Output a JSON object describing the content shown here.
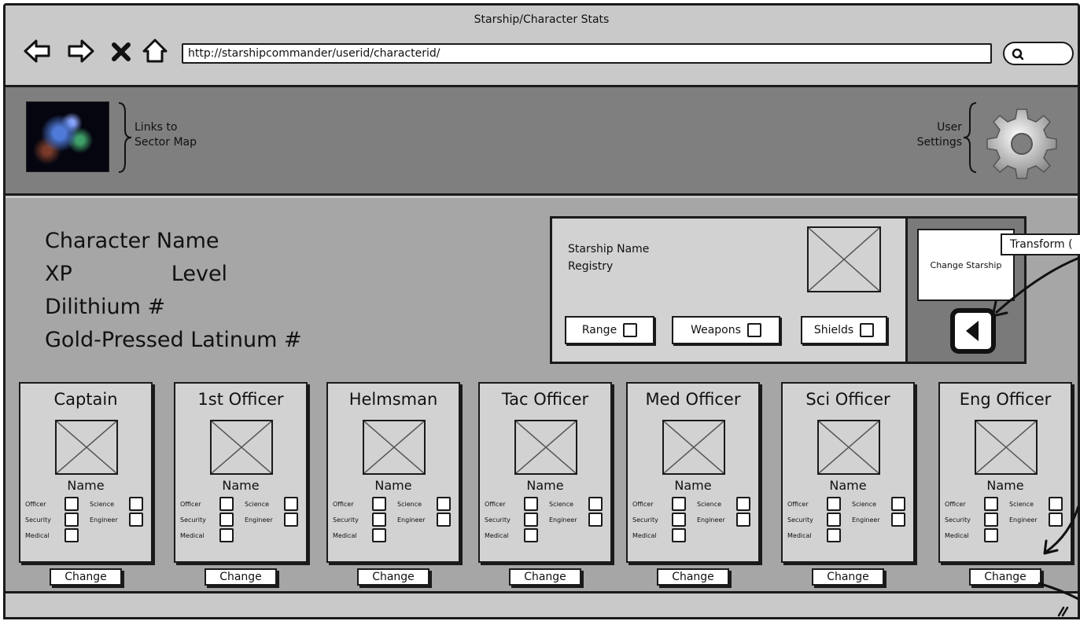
{
  "window": {
    "title": "Starship/Character Stats"
  },
  "browser": {
    "url": "http://starshipcommander/userid/characterid/",
    "nav_icons": [
      "back-arrow-icon",
      "forward-arrow-icon",
      "stop-x-icon",
      "home-icon"
    ],
    "search_icon": "search-icon"
  },
  "header": {
    "map_link_label": "Links to\nSector Map",
    "settings_label": "User\nSettings"
  },
  "character": {
    "name": "Character Name",
    "xp": "XP",
    "level": "Level",
    "dilithium": "Dilithium #",
    "latinum": "Gold-Pressed Latinum #"
  },
  "starship": {
    "name": "Starship Name",
    "registry": "Registry",
    "range_label": "Range",
    "weapons_label": "Weapons",
    "shields_label": "Shields",
    "change_label": "Change Starship",
    "tooltip": "Transform ("
  },
  "crew": [
    {
      "role": "Captain",
      "name": "Name",
      "change": "Change"
    },
    {
      "role": "1st Officer",
      "name": "Name",
      "change": "Change"
    },
    {
      "role": "Helmsman",
      "name": "Name",
      "change": "Change"
    },
    {
      "role": "Tac Officer",
      "name": "Name",
      "change": "Change"
    },
    {
      "role": "Med Officer",
      "name": "Name",
      "change": "Change"
    },
    {
      "role": "Sci Officer",
      "name": "Name",
      "change": "Change"
    },
    {
      "role": "Eng Officer",
      "name": "Name",
      "change": "Change"
    }
  ],
  "skills": {
    "officer": "Officer",
    "science": "Science",
    "security": "Security",
    "engineer": "Engineer",
    "medical": "Medical"
  }
}
